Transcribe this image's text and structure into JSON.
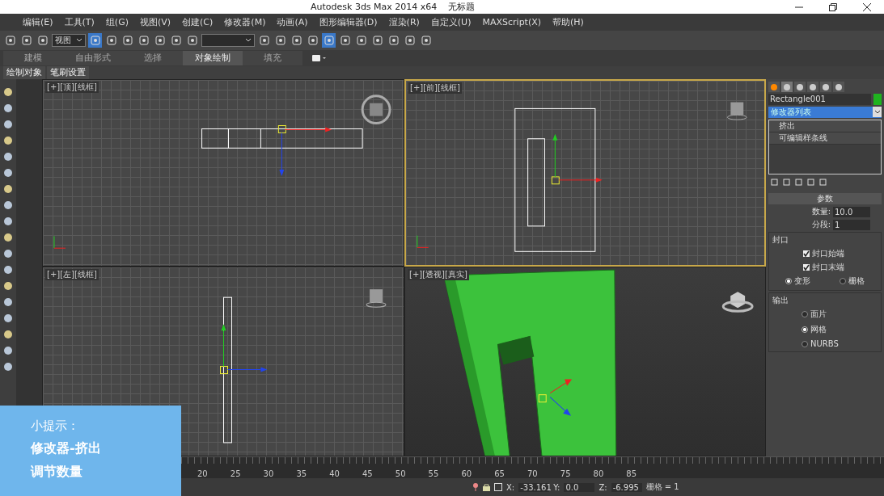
{
  "window": {
    "title": "Autodesk 3ds Max  2014 x64",
    "document": "无标题"
  },
  "menu": [
    "编辑(E)",
    "工具(T)",
    "组(G)",
    "视图(V)",
    "创建(C)",
    "修改器(M)",
    "动画(A)",
    "图形编辑器(D)",
    "渲染(R)",
    "自定义(U)",
    "MAXScript(X)",
    "帮助(H)"
  ],
  "toolbar": {
    "view_dropdown": "视图",
    "tools": [
      {
        "selected": false
      },
      {
        "selected": false
      },
      {
        "selected": false
      },
      {
        "selected": true
      },
      {
        "selected": false
      },
      {
        "selected": false
      },
      {
        "selected": false
      },
      {
        "selected": false
      },
      {
        "selected": false
      },
      {
        "selected": false
      },
      {
        "selected": false
      },
      {
        "selected": false
      },
      {
        "selected": false
      },
      {
        "selected": false
      },
      {
        "selected": true
      },
      {
        "selected": false
      },
      {
        "selected": false
      },
      {
        "selected": false
      },
      {
        "selected": false
      },
      {
        "selected": false
      },
      {
        "selected": false
      }
    ]
  },
  "ribbon_tabs": [
    {
      "label": "建模",
      "selected": false
    },
    {
      "label": "自由形式",
      "selected": false
    },
    {
      "label": "选择",
      "selected": false
    },
    {
      "label": "对象绘制",
      "selected": true
    },
    {
      "label": "填充",
      "selected": false
    }
  ],
  "subtabs": [
    "绘制对象",
    "笔刷设置"
  ],
  "viewports": [
    {
      "label": "[+][顶][线框]",
      "kind": "top",
      "active": false
    },
    {
      "label": "[+][前][线框]",
      "kind": "front",
      "active": true
    },
    {
      "label": "[+][左][线框]",
      "kind": "left",
      "active": false
    },
    {
      "label": "[+][透视][真实]",
      "kind": "perspective",
      "active": false
    }
  ],
  "command_panel": {
    "tabs": [
      {
        "selected": false
      },
      {
        "selected": true
      },
      {
        "selected": false
      },
      {
        "selected": false
      },
      {
        "selected": false
      },
      {
        "selected": false
      }
    ],
    "object_name": "Rectangle001",
    "modifier_list": "修改器列表",
    "stack": [
      {
        "label": "挤出",
        "selected": false
      },
      {
        "label": "可编辑样条线",
        "selected": false
      }
    ],
    "rollout": "参数",
    "fields": [
      {
        "label": "数量:",
        "value": "10.0"
      },
      {
        "label": "分段:",
        "value": "1"
      }
    ],
    "groups": [
      {
        "title": "封口",
        "checks": [
          {
            "label": "封口始端",
            "checked": true
          },
          {
            "label": "封口末端",
            "checked": true
          }
        ],
        "radios": [
          {
            "label": "变形",
            "selected": true
          },
          {
            "label": "栅格",
            "selected": false
          }
        ]
      },
      {
        "title": "输出",
        "radios": [
          {
            "label": "面片",
            "selected": false
          },
          {
            "label": "网格",
            "selected": true
          },
          {
            "label": "NURBS",
            "selected": false
          }
        ]
      }
    ]
  },
  "timeline": [
    "20",
    "25",
    "30",
    "35",
    "40",
    "45",
    "50",
    "55",
    "60",
    "65",
    "70",
    "75",
    "80",
    "85"
  ],
  "status": {
    "coords": [
      {
        "axis": "X:",
        "value": "-33.161"
      },
      {
        "axis": "Y:",
        "value": "0.0"
      },
      {
        "axis": "Z:",
        "value": "-6.995"
      }
    ],
    "grid": "栅格 = 1"
  },
  "tip": {
    "title": "小提示：",
    "lines": [
      "修改器-挤出",
      "调节数量"
    ]
  }
}
